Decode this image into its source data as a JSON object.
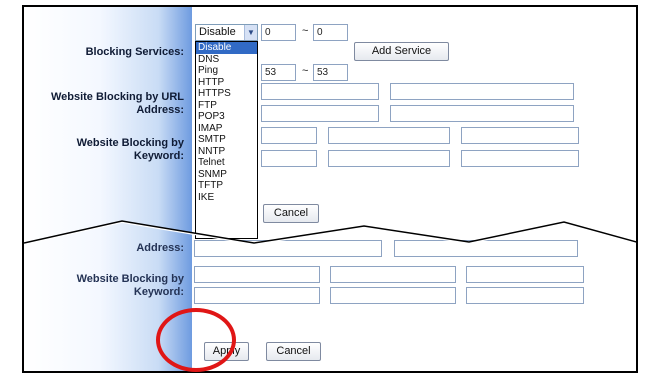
{
  "top_section": {
    "blocking_services_label": "Blocking Services:",
    "service_select": {
      "selected": "Disable"
    },
    "service_options": [
      "Disable",
      "DNS",
      "Ping",
      "HTTP",
      "HTTPS",
      "FTP",
      "POP3",
      "IMAP",
      "SMTP",
      "NNTP",
      "Telnet",
      "SNMP",
      "TFTP",
      "IKE"
    ],
    "port_range_1": {
      "from": "0",
      "to": "0"
    },
    "port_range_2": {
      "from": "53",
      "to": "53"
    },
    "range_separator": "~",
    "add_service_button": "Add Service",
    "url_label_line1": "Website Blocking by URL",
    "url_label_line2": "Address:",
    "keyword_label_line1": "Website Blocking by",
    "keyword_label_line2": "Keyword:",
    "cancel_button": "Cancel"
  },
  "bottom_section": {
    "address_label": "Address:",
    "keyword_label_line1": "Website Blocking by",
    "keyword_label_line2": "Keyword:",
    "apply_button": "Apply",
    "cancel_button": "Cancel"
  },
  "colors": {
    "highlight_circle": "#e01616",
    "selected_option_bg": "#316ac5",
    "sidebar_gradient_end": "#6e9be0"
  }
}
